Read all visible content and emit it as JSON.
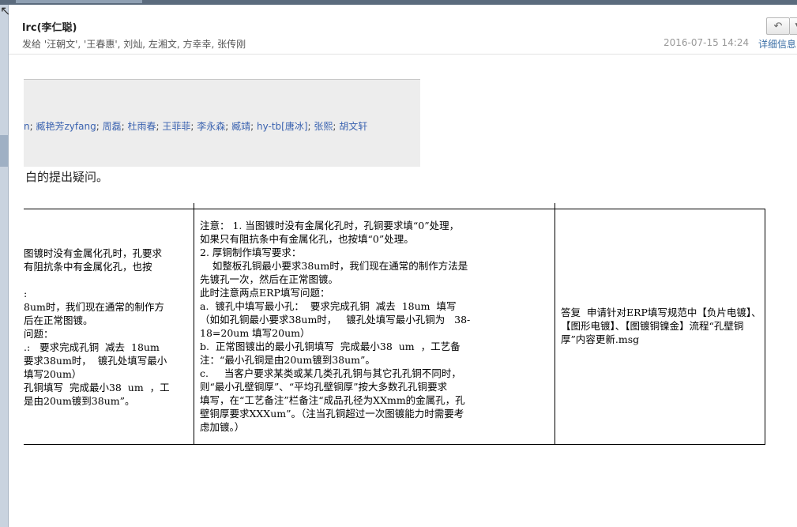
{
  "email": {
    "sender": "lrc(李仁聪)",
    "recipients": "发给 '汪朝文', '王春惠', 刘灿, 左湘文, 方幸幸, 张传刚",
    "datetime": "2016-07-15 14:24",
    "details_link": "详细信息"
  },
  "toolbar": {
    "reply_icon": "reply-arrow-icon",
    "menu_icon": "chevron-down-icon"
  },
  "quoted": {
    "recipients": [
      "n",
      "臧艳芳zyfang",
      "周磊",
      "杜雨春",
      "王菲菲",
      "李永森",
      "臧靖",
      "hy-tb[唐冰]",
      "张熙",
      "胡文轩"
    ],
    "separator": ";"
  },
  "body_line": "白的提出疑问。",
  "table": {
    "col1_text": "图镀时没有金属化孔时，孔要求\n有阻抗条中有金属化孔，也按\n\n:\n8um时，我们现在通常的制作方\n后在正常图镀。\n问题：\n.:   要求完成孔铜  减去  18um\n要求38um时，  镀孔处填写最小\n填写20um）\n孔铜填写  完成最小38  um  ，工\n是由20um镀到38um”。",
    "col2_text": "注意： 1. 当图镀时没有金属化孔时，孔铜要求填“0”处理，\n如果只有阻抗条中有金属化孔，也按填“0”处理。\n2. 厚铜制作填写要求：\n    如整板孔铜最小要求38um时，我们现在通常的制作方法是\n先镀孔一次，然后在正常图镀。\n此时注意两点ERP填写问题：\na.  镀孔中填写最小孔：  要求完成孔铜  减去  18um  填写\n（如如孔铜最小要求38um时，   镀孔处填写最小孔铜为   38-\n18=20um 填写20um）\nb.  正常图镀出的最小孔铜填写  完成最小38  um  ，工艺备\n注：“最小孔铜是由20um镀到38um”。\nc.     当客户要求某类或某几类孔孔铜与其它孔孔铜不同时，\n则“最小孔壁铜厚”、“平均孔壁铜厚”按大多数孔孔铜要求\n填写，在“工艺备注”栏备注“成品孔径为XXmm的金属孔，孔\n壁铜厚要求XXXum”。（注当孔铜超过一次图镀能力时需要考\n虑加镀。）",
    "col3_text": "答复  申请针对ERP填写规范中【负片电镀】、【图形电镀】、【图镀铜镍金】流程“孔壁铜厚”内容更新.msg"
  }
}
